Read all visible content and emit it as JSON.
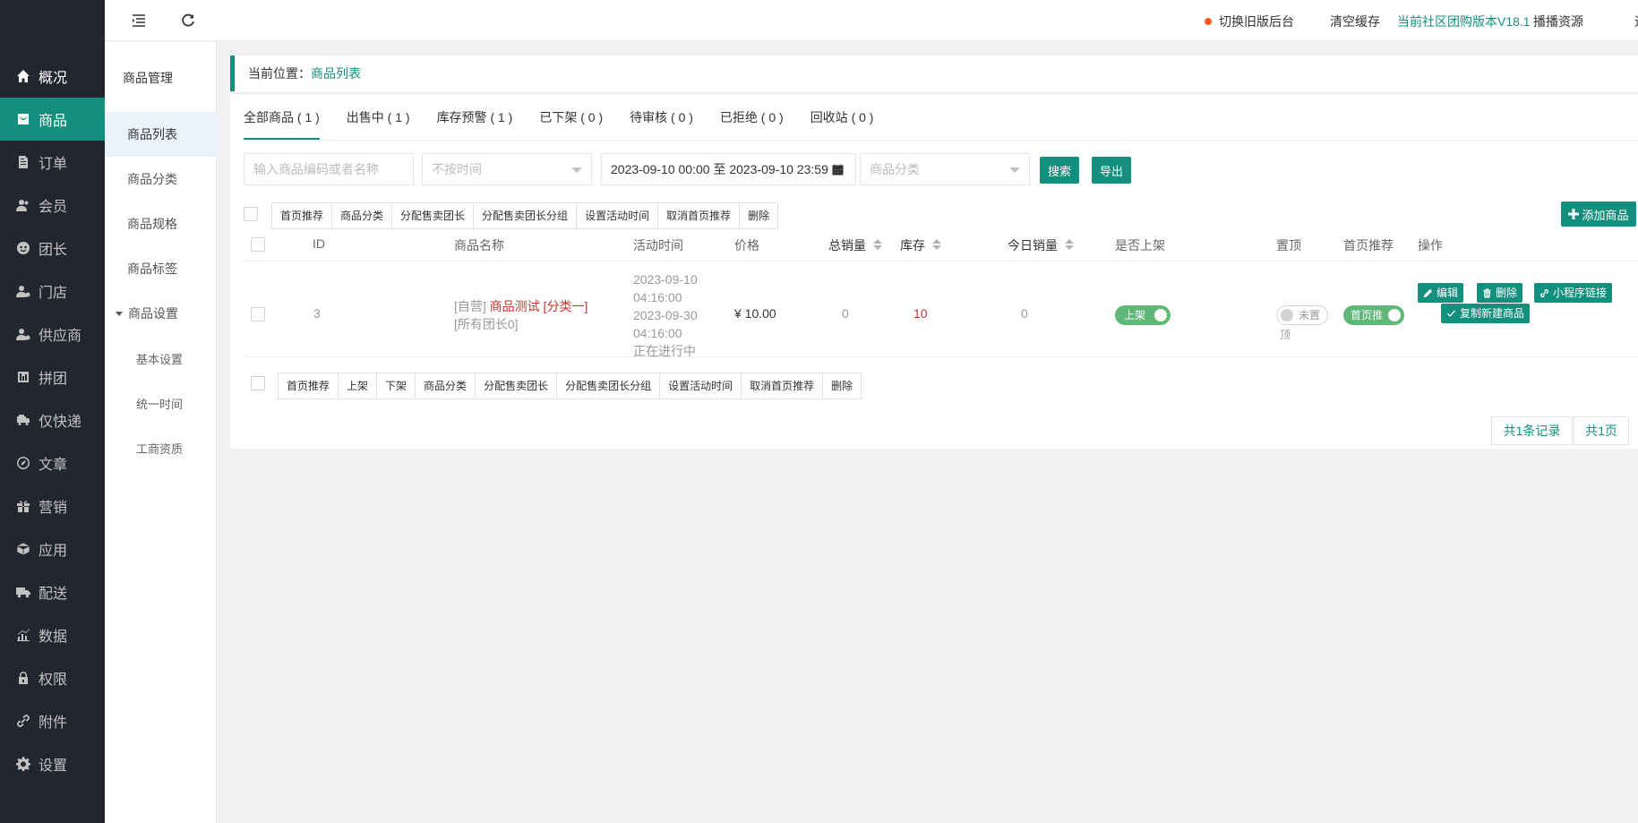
{
  "nav": {
    "items": [
      {
        "label": "概况",
        "icon": "home-icon"
      },
      {
        "label": "商品",
        "icon": "shopping-bag-icon"
      },
      {
        "label": "订单",
        "icon": "order-icon"
      },
      {
        "label": "会员",
        "icon": "member-icon"
      },
      {
        "label": "团长",
        "icon": "leader-icon"
      },
      {
        "label": "门店",
        "icon": "store-icon"
      },
      {
        "label": "供应商",
        "icon": "supplier-icon"
      },
      {
        "label": "拼团",
        "icon": "group-buy-icon"
      },
      {
        "label": "仅快递",
        "icon": "express-icon"
      },
      {
        "label": "文章",
        "icon": "compass-icon"
      },
      {
        "label": "营销",
        "icon": "gift-icon"
      },
      {
        "label": "应用",
        "icon": "cube-icon"
      },
      {
        "label": "配送",
        "icon": "truck-icon"
      },
      {
        "label": "数据",
        "icon": "chart-icon"
      },
      {
        "label": "权限",
        "icon": "lock-icon"
      },
      {
        "label": "附件",
        "icon": "link-icon"
      },
      {
        "label": "设置",
        "icon": "gear-icon"
      }
    ],
    "active_index": 1
  },
  "subnav": {
    "title": "商品管理",
    "items": [
      "商品列表",
      "商品分类",
      "商品规格",
      "商品标签"
    ],
    "group": "商品设置",
    "children": [
      "基本设置",
      "统一时间",
      "工商资质"
    ]
  },
  "header": {
    "switch_old": "切换旧版后台",
    "clear_cache": "清空缓存",
    "version": "当前社区团购版本V18.1",
    "broadcast": "播播资源",
    "extra": "退"
  },
  "breadcrumb": {
    "prefix": "当前位置：",
    "current": "商品列表"
  },
  "tabs": [
    "全部商品 ( 1 )",
    "出售中 ( 1 )",
    "库存预警 ( 1 )",
    "已下架 ( 0 )",
    "待审核 ( 0 )",
    "已拒绝 ( 0 )",
    "回收站 ( 0 )"
  ],
  "filters": {
    "keyword_placeholder": "输入商品编码或者名称",
    "time_select": "不按时间",
    "date_range": "2023-09-10 00:00 至 2023-09-10 23:59",
    "category_placeholder": "商品分类",
    "search_label": "搜索",
    "export_label": "导出"
  },
  "top_actions": [
    "首页推荐",
    "商品分类",
    "分配售卖团长",
    "分配售卖团长分组",
    "设置活动时间",
    "取消首页推荐",
    "删除"
  ],
  "add_button": "添加商品",
  "table": {
    "headers": {
      "id": "ID",
      "name": "商品名称",
      "time": "活动时间",
      "price": "价格",
      "total_sales": "总销量",
      "stock": "库存",
      "today_sales": "今日销量",
      "on_shelf": "是否上架",
      "top": "置顶",
      "home_rec": "首页推荐",
      "ops": "操作"
    },
    "rows": [
      {
        "id": "3",
        "tag": "[自营]",
        "name": "商品测试 [分类一]",
        "leader": "[所有团长0]",
        "start_date": "2023-09-10",
        "start_time": "04:16:00",
        "end_date": "2023-09-30",
        "end_time": "04:16:00",
        "status": "正在进行中",
        "price": "¥ 10.00",
        "total_sales": "0",
        "stock": "10",
        "today_sales": "0",
        "on_shelf_label": "上架",
        "top_label": "未置",
        "top_label_wrap": "顶",
        "home_rec_label": "首页推",
        "ops": {
          "edit": "编辑",
          "delete": "删除",
          "mini_link": "小程序链接",
          "copy": "复制新建商品"
        }
      }
    ]
  },
  "bottom_actions": [
    "首页推荐",
    "上架",
    "下架",
    "商品分类",
    "分配售卖团长",
    "分配售卖团长分组",
    "设置活动时间",
    "取消首页推荐",
    "删除"
  ],
  "pager": {
    "total": "共1条记录",
    "pages": "共1页"
  }
}
